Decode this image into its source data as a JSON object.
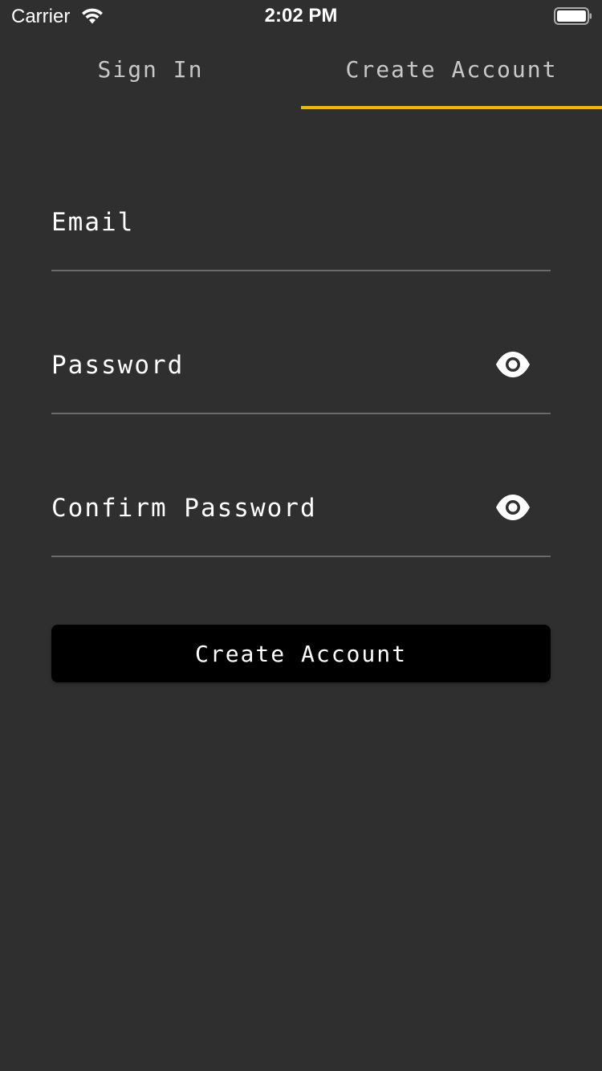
{
  "status_bar": {
    "carrier": "Carrier",
    "time": "2:02 PM",
    "wifi_icon": "wifi-icon",
    "battery_icon": "battery-full-icon"
  },
  "tabs": [
    {
      "label": "Sign In",
      "selected": false
    },
    {
      "label": "Create Account",
      "selected": true
    }
  ],
  "form": {
    "email": {
      "placeholder": "Email",
      "value": ""
    },
    "password": {
      "placeholder": "Password",
      "value": "",
      "toggle_icon": "eye-icon"
    },
    "confirm_password": {
      "placeholder": "Confirm Password",
      "value": "",
      "toggle_icon": "eye-icon"
    },
    "submit_label": "Create Account"
  },
  "colors": {
    "background": "#2f2f2f",
    "accent": "#f5b800",
    "text": "#ffffff",
    "tab_text": "#c8c8c8",
    "underline": "#6a6a6a",
    "button_bg": "#000000"
  }
}
